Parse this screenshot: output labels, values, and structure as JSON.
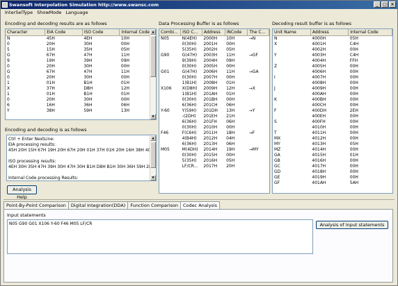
{
  "title": "Swansoft Interpolation Simulation http://www.swansc.com",
  "menu": [
    "InterSelType",
    "ShowMode",
    "Language"
  ],
  "left": {
    "table_label": "Encoding and decoding results are as follows",
    "columns": [
      "Character",
      "EIA Code",
      "ISO Code",
      "Internal Code"
    ],
    "rows": [
      [
        "N",
        "45H",
        "4EH",
        "10H"
      ],
      [
        "0",
        "20H",
        "30H",
        "00H"
      ],
      [
        "5",
        "15H",
        "35H",
        "05H"
      ],
      [
        "G",
        "67H",
        "47H",
        "11H"
      ],
      [
        "9",
        "19H",
        "39H",
        "09H"
      ],
      [
        "0",
        "20H",
        "30H",
        "00H"
      ],
      [
        "G",
        "67H",
        "47H",
        "11H"
      ],
      [
        "0",
        "20H",
        "30H",
        "00H"
      ],
      [
        "1",
        "01H",
        "B1H",
        "01H"
      ],
      [
        "X",
        "37H",
        "D8H",
        "12H"
      ],
      [
        "1",
        "01H",
        "B1H",
        "01H"
      ],
      [
        "0",
        "20H",
        "30H",
        "00H"
      ],
      [
        "6",
        "16H",
        "36H",
        "06H"
      ],
      [
        "Y",
        "38H",
        "59H",
        "13H"
      ]
    ],
    "text_label": "Encoding and decoding is as follows",
    "text_lines": [
      "Ctrl + Enter NextLine:",
      "EIA processing results:",
      "45H 20H 15H 67H 19H 20H 67H 20H 01H 37H 01H 20H 16H 38H 40H 16H",
      "",
      "ISO processing results:",
      "4EH 30H 35H 47H 39H 30H 47H 30H B1H D8H B1H 30H 36H 59H 2DH 36H",
      "",
      "Internal Code processing Results:"
    ],
    "help_button": "Analysis Help"
  },
  "middle": {
    "label": "Data Processing Buffer is as follows",
    "columns": [
      "Combi...",
      "ISO C...",
      "Address",
      "INCode",
      "The C..."
    ],
    "rows": [
      [
        "N05",
        "N(4EH)",
        "2000H",
        "10H",
        "→N"
      ],
      [
        "",
        "0(30H)",
        "2001H",
        "00H",
        ""
      ],
      [
        "",
        "5(35H)",
        "2002H",
        "05H",
        ""
      ],
      [
        "G90",
        "G(47H)",
        "2003H",
        "11H",
        "→GF"
      ],
      [
        "",
        "9(39H)",
        "2004H",
        "09H",
        ""
      ],
      [
        "",
        "0(30H)",
        "2005H",
        "00H",
        ""
      ],
      [
        "G01",
        "G(47H)",
        "2006H",
        "11H",
        "→GA"
      ],
      [
        "",
        "0(30H)",
        "2007H",
        "00H",
        ""
      ],
      [
        "",
        "1(B1H)",
        "2008H",
        "01H",
        ""
      ],
      [
        "X106",
        "X(D8H)",
        "2009H",
        "12H",
        "→X"
      ],
      [
        "",
        "1(B1H)",
        "201AH",
        "01H",
        ""
      ],
      [
        "",
        "0(30H)",
        "201BH",
        "00H",
        ""
      ],
      [
        "",
        "6(36H)",
        "201CH",
        "06H",
        ""
      ],
      [
        "Y-60",
        "Y(59H)",
        "201DH",
        "13H",
        "→Y"
      ],
      [
        "",
        "-(2DH)",
        "201EH",
        "21H",
        ""
      ],
      [
        "",
        "6(36H)",
        "201FH",
        "06H",
        ""
      ],
      [
        "",
        "0(30H)",
        "2010H",
        "00H",
        ""
      ],
      [
        "F46",
        "F(C6H)",
        "2011H",
        "18H",
        "→F"
      ],
      [
        "",
        "4(B4H)",
        "2012H",
        "04H",
        ""
      ],
      [
        "",
        "6(36H)",
        "2013H",
        "06H",
        ""
      ],
      [
        "M05",
        "M(4DH)",
        "2014H",
        "19H",
        "→MY"
      ],
      [
        "",
        "0(30H)",
        "2015H",
        "00H",
        ""
      ],
      [
        "",
        "5(35H)",
        "2016H",
        "05H",
        ""
      ],
      [
        "",
        "LF/CR...",
        "2017H",
        "20H",
        ""
      ]
    ]
  },
  "right": {
    "label": "Decoding result buffer is as follows",
    "columns": [
      "Unit Name",
      "Address",
      "Internal Code"
    ],
    "rows": [
      [
        "N",
        "4000H",
        "05H"
      ],
      [
        "X",
        "4001H",
        "C4H"
      ],
      [
        "",
        "4002H",
        "00H"
      ],
      [
        "Y",
        "4003H",
        "C4H"
      ],
      [
        "",
        "4004H",
        "FFH"
      ],
      [
        "Z",
        "4005H",
        "00H"
      ],
      [
        "",
        "4006H",
        "00H"
      ],
      [
        "I",
        "4007H",
        "00H"
      ],
      [
        "",
        "4008H",
        "00H"
      ],
      [
        "J",
        "4009H",
        "00H"
      ],
      [
        "",
        "400AH",
        "00H"
      ],
      [
        "K",
        "400BH",
        "00H"
      ],
      [
        "",
        "400CH",
        "00H"
      ],
      [
        "F",
        "400DH",
        "2EH"
      ],
      [
        "",
        "400EH",
        "00H"
      ],
      [
        "S",
        "400FH",
        "00H"
      ],
      [
        "",
        "4010H",
        "00H"
      ],
      [
        "T",
        "4011H",
        "00H"
      ],
      [
        "MX",
        "4012H",
        "00H"
      ],
      [
        "MY",
        "4013H",
        "05H"
      ],
      [
        "MZ",
        "4014H",
        "00H"
      ],
      [
        "GA",
        "4015H",
        "01H"
      ],
      [
        "GB",
        "4016H",
        "00H"
      ],
      [
        "GC",
        "4017H",
        "00H"
      ],
      [
        "GD",
        "4018H",
        "00H"
      ],
      [
        "GE",
        "4019H",
        "00H"
      ],
      [
        "GF",
        "401AH",
        "5AH"
      ]
    ]
  },
  "tabs": [
    "Point-By-Point Comparison",
    "Digital Integration(DDA)",
    "Function Comparison",
    "Codec Analysis"
  ],
  "active_tab": 3,
  "input": {
    "label": "Input statements",
    "value": "N05 G90 G01 X106 Y-60 F46 M05 LF/CR",
    "analyze_button": "Analysis of input statements"
  }
}
